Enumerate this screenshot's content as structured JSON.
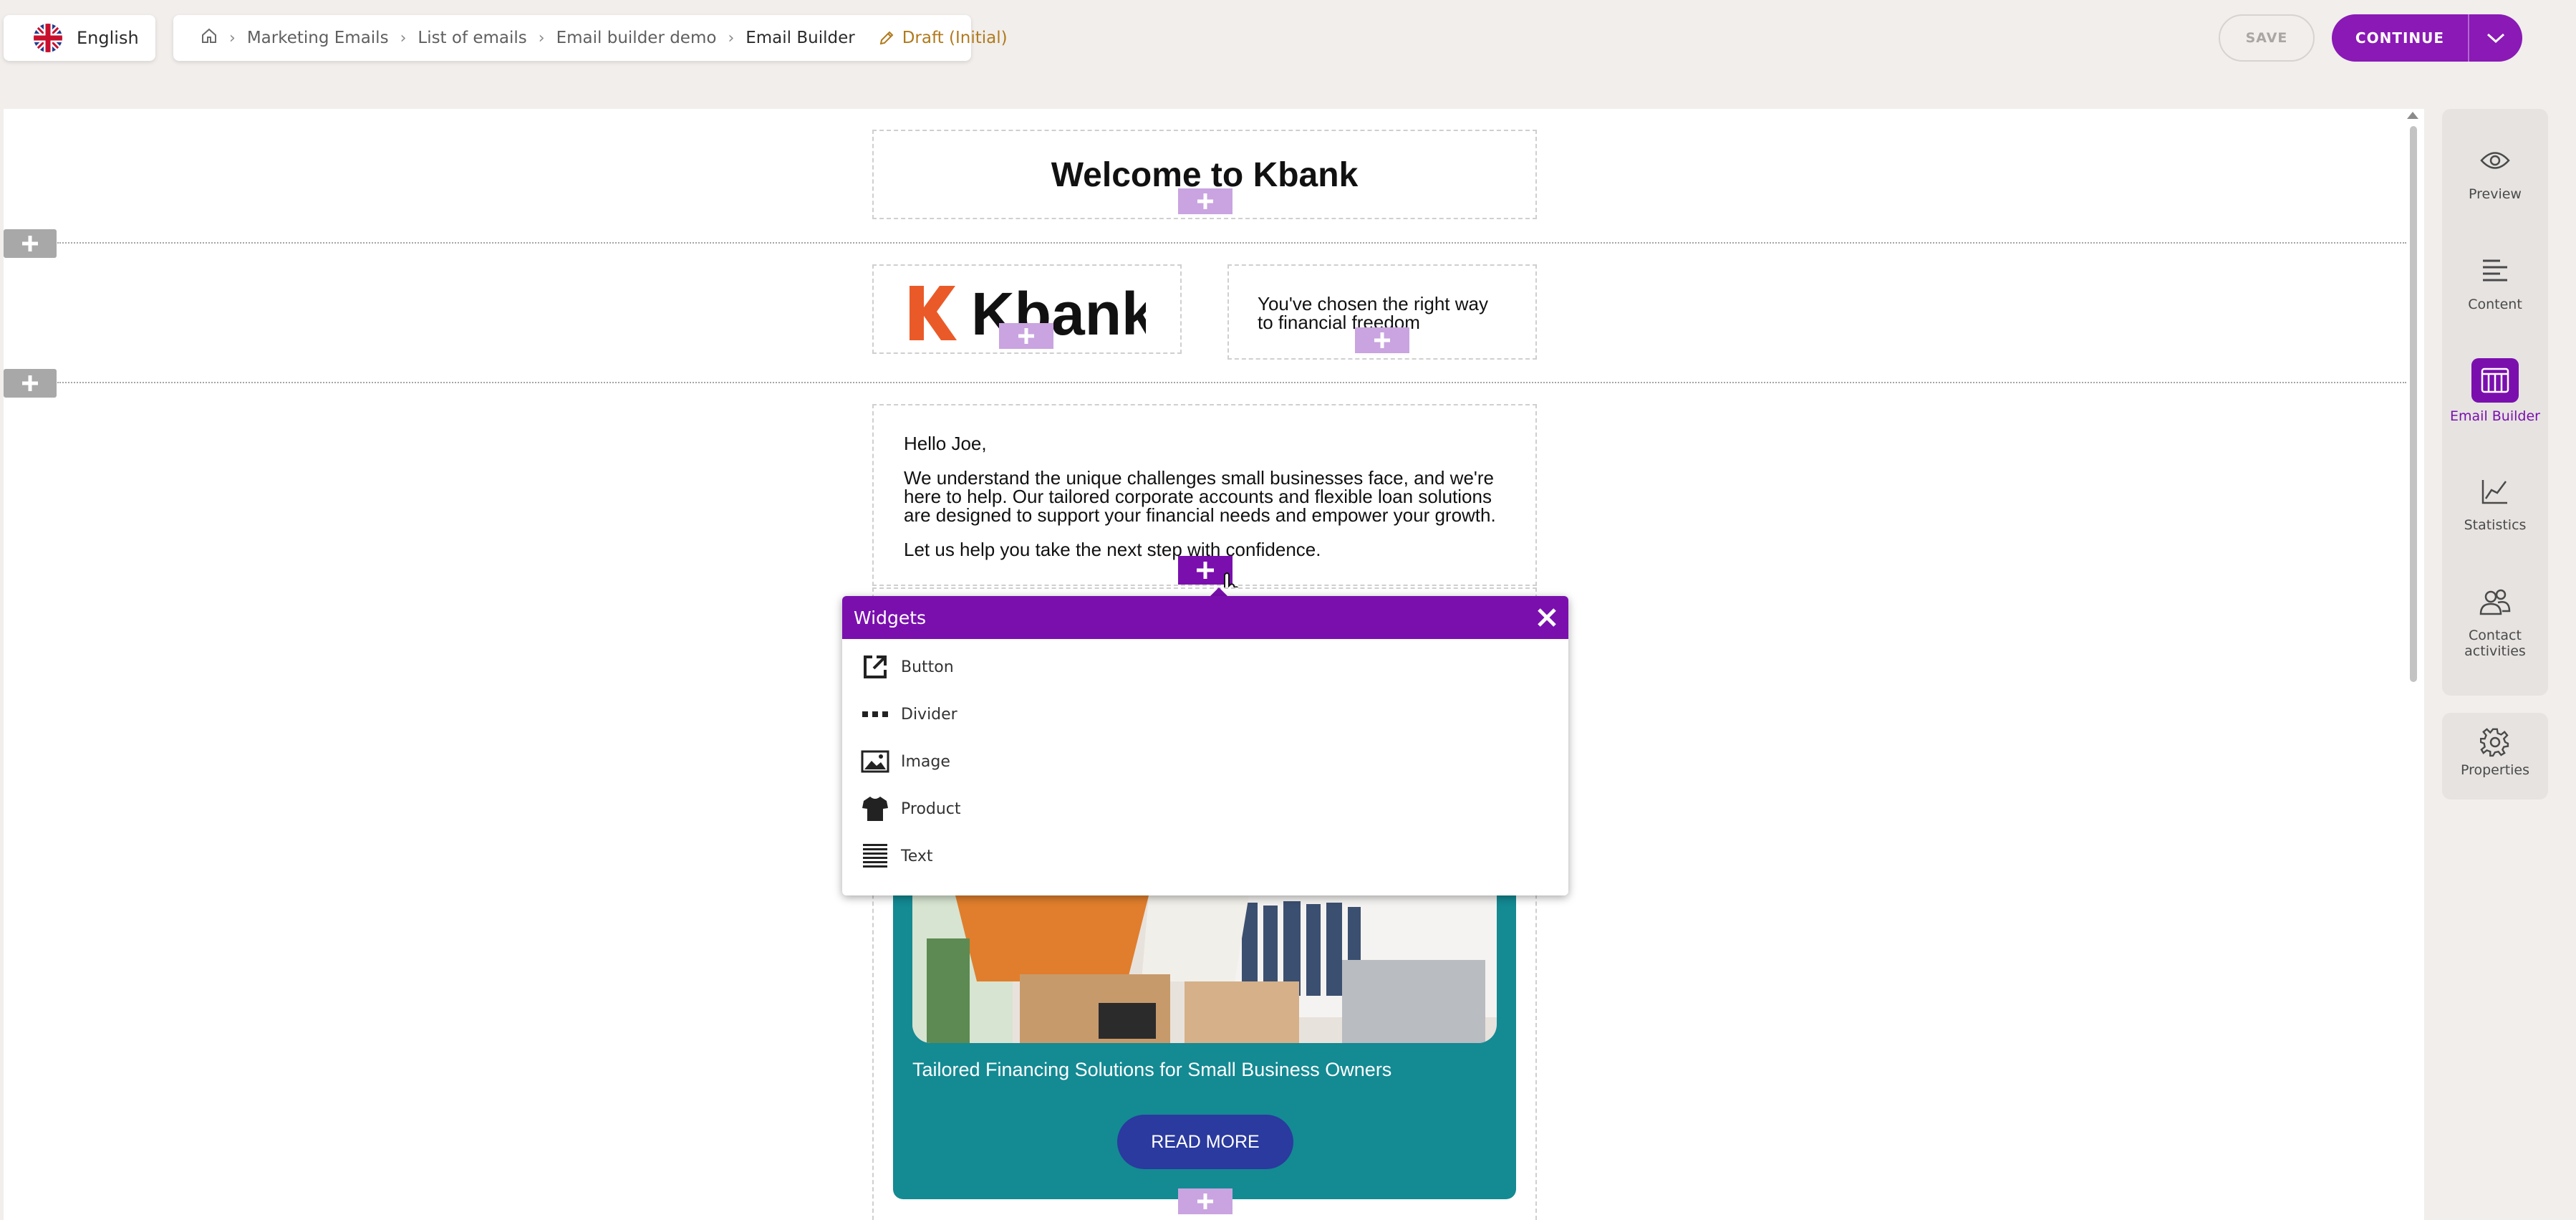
{
  "language": {
    "label": "English",
    "icon": "uk-flag-icon"
  },
  "breadcrumb": {
    "home_icon": "home-icon",
    "items": [
      "Marketing Emails",
      "List of emails",
      "Email builder demo",
      "Email Builder"
    ],
    "status": "Draft (Initial)",
    "status_icon": "pencil-icon"
  },
  "actions": {
    "save": "SAVE",
    "continue": "CONTINUE"
  },
  "email": {
    "title": "Welcome to Kbank",
    "logo_text": "Kbank",
    "tagline": "You've chosen the right way to financial freedom",
    "greeting": "Hello Joe,",
    "body_lines": [
      "We understand the unique challenges small businesses face, and we're",
      "here to help. Our tailored corporate accounts and flexible loan solutions",
      "are designed to support your financial needs and empower your growth."
    ],
    "closing": "Let us help you take the next step with confidence.",
    "promo_caption": "Tailored Financing Solutions for Small Business Owners",
    "promo_button": "READ MORE"
  },
  "widgets": {
    "title": "Widgets",
    "items": [
      {
        "label": "Button",
        "icon": "external-link-icon"
      },
      {
        "label": "Divider",
        "icon": "divider-icon"
      },
      {
        "label": "Image",
        "icon": "image-icon"
      },
      {
        "label": "Product",
        "icon": "shirt-icon"
      },
      {
        "label": "Text",
        "icon": "text-lines-icon"
      }
    ]
  },
  "sidebar": {
    "items": [
      {
        "label": "Preview",
        "icon": "eye-icon"
      },
      {
        "label": "Content",
        "icon": "align-left-icon"
      },
      {
        "label": "Email Builder",
        "icon": "email-builder-icon",
        "active": true
      },
      {
        "label": "Statistics",
        "icon": "chart-icon"
      },
      {
        "label": "Contact activities",
        "icon": "people-icon"
      }
    ],
    "properties": {
      "label": "Properties",
      "icon": "gear-icon"
    }
  },
  "colors": {
    "brand": "#8a19b5",
    "widget_header": "#7a0fae",
    "promo_bg": "#148a93",
    "kbank_orange": "#ea5a28"
  }
}
